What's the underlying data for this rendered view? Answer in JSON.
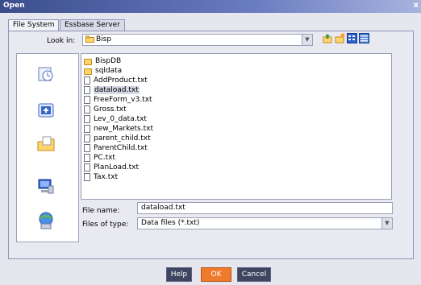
{
  "window": {
    "title": "Open",
    "close_glyph": "x"
  },
  "tabs": [
    {
      "label": "File System",
      "active": true
    },
    {
      "label": "Essbase Server",
      "active": false
    }
  ],
  "lookin": {
    "label": "Look in:",
    "value": "Bisp"
  },
  "toolbar": {
    "buttons": [
      "up-folder-icon",
      "new-folder-icon",
      "list-view-icon",
      "details-view-icon"
    ]
  },
  "sidebar": {
    "icons": [
      "recent-icon",
      "desktop-icon",
      "my-documents-icon",
      "my-computer-icon",
      "network-icon"
    ]
  },
  "files": [
    {
      "name": "BispDB",
      "type": "folder"
    },
    {
      "name": "sqldata",
      "type": "folder"
    },
    {
      "name": "AddProduct.txt",
      "type": "file"
    },
    {
      "name": "dataload.txt",
      "type": "file",
      "selected": true
    },
    {
      "name": "FreeForm_v3.txt",
      "type": "file"
    },
    {
      "name": "Gross.txt",
      "type": "file"
    },
    {
      "name": "Lev_0_data.txt",
      "type": "file"
    },
    {
      "name": "new_Markets.txt",
      "type": "file"
    },
    {
      "name": "parent_child.txt",
      "type": "file"
    },
    {
      "name": "ParentChild.txt",
      "type": "file"
    },
    {
      "name": "PC.txt",
      "type": "file"
    },
    {
      "name": "PlanLoad.txt",
      "type": "file"
    },
    {
      "name": "Tax.txt",
      "type": "file"
    }
  ],
  "filename": {
    "label": "File name:",
    "value": "dataload.txt"
  },
  "filetype": {
    "label": "Files of type:",
    "value": "Data files (*.txt)"
  },
  "buttons": {
    "help": "Help",
    "ok": "OK",
    "cancel": "Cancel"
  },
  "colors": {
    "accent_ok": "#f07a2c",
    "button_dark": "#3d4560",
    "title_bar": "#3a4d8c"
  }
}
